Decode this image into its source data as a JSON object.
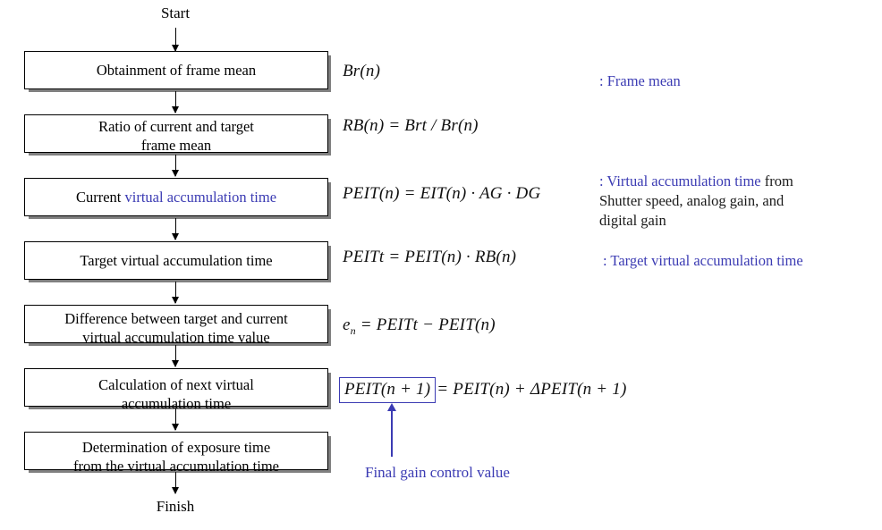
{
  "diagram": {
    "title": "Exposure / gain control flowchart",
    "start_label": "Start",
    "finish_label": "Finish",
    "accent_blue": "#3b3bb3",
    "box_border": "#000000",
    "box_shadow": "#808080",
    "steps": [
      {
        "id": "step-1",
        "line1": "Obtainment of frame mean",
        "line2": "",
        "highlight": ""
      },
      {
        "id": "step-2",
        "line1": "Ratio of current and target",
        "line2": "frame mean",
        "highlight": ""
      },
      {
        "id": "step-3",
        "line1_prefix": "Current ",
        "line1": "Current virtual accumulation time",
        "line2": "",
        "highlight": "virtual accumulation time"
      },
      {
        "id": "step-4",
        "line1": "Target virtual accumulation time",
        "line2": "",
        "highlight": ""
      },
      {
        "id": "step-5",
        "line1": "Difference between target and current",
        "line2": "virtual accumulation time value",
        "highlight": ""
      },
      {
        "id": "step-6",
        "line1": "Calculation of next virtual",
        "line2": "accumulation time",
        "highlight": ""
      },
      {
        "id": "step-7",
        "line1": "Determination of exposure time",
        "line2": "from the virtual accumulation time",
        "highlight": ""
      }
    ],
    "formulas": [
      {
        "id": "formula-1",
        "text": "Br(n)"
      },
      {
        "id": "formula-2",
        "text": "RB(n) = Brt / Br(n)"
      },
      {
        "id": "formula-3",
        "text": "PEIT(n) = EIT(n) · AG · DG"
      },
      {
        "id": "formula-4",
        "text": "PEITt = PEIT(n) · RB(n)"
      },
      {
        "id": "formula-5",
        "text": "e",
        "subscript": "n",
        "rest": " = PEITt − PEIT(n)"
      },
      {
        "id": "formula-6",
        "boxed": "PEIT(n + 1)",
        "rest": "= PEIT(n) + ΔPEIT(n + 1)"
      }
    ],
    "annotations": [
      {
        "id": "annotation-frame-mean",
        "blue": ": Frame mean",
        "black": ""
      },
      {
        "id": "annotation-virtual-accumulation",
        "blue": ": Virtual accumulation time",
        "black": " from\nShutter speed, analog gain, and\ndigital gain"
      },
      {
        "id": "annotation-target-virtual",
        "blue": ": Target virtual accumulation time",
        "black": ""
      }
    ],
    "pointer_caption": "Final gain control value"
  }
}
